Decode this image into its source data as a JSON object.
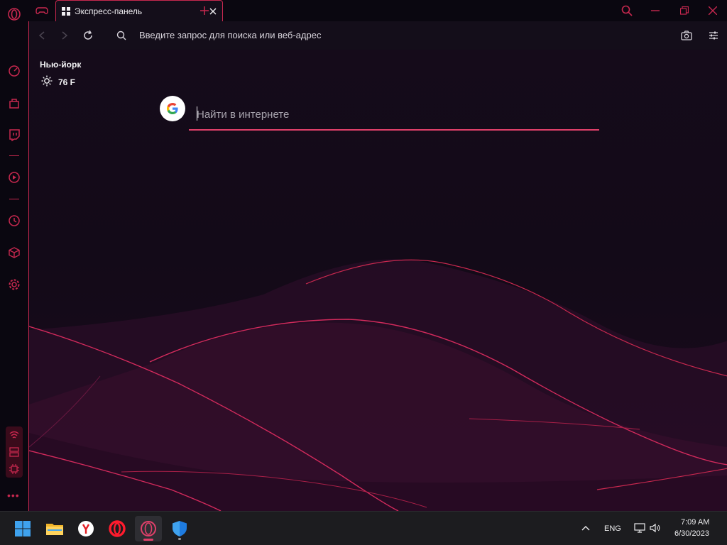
{
  "browser": {
    "tab_title": "Экспресс-панель",
    "address_placeholder": "Введите запрос для поиска или веб-адрес",
    "accent_color": "#c8284f"
  },
  "weather": {
    "city": "Нью-йорк",
    "temperature": "76 F",
    "condition_icon": "sun-icon"
  },
  "search": {
    "engine_icon": "google-g-icon",
    "placeholder": "Найти в интернете",
    "value": ""
  },
  "sidebar": {
    "items": [
      {
        "name": "speed-dial-icon"
      },
      {
        "name": "shopping-bag-icon"
      },
      {
        "name": "twitch-icon"
      },
      {
        "name": "player-icon"
      },
      {
        "name": "history-icon"
      },
      {
        "name": "extensions-cube-icon"
      },
      {
        "name": "settings-gear-icon"
      }
    ],
    "bottom_widgets": [
      "wifi-icon",
      "storage-icon",
      "cpu-icon"
    ],
    "more_label": "•••"
  },
  "taskbar": {
    "apps": [
      "windows-start-icon",
      "file-explorer-icon",
      "yandex-browser-icon",
      "opera-icon",
      "opera-gx-icon",
      "windows-security-icon"
    ],
    "language": "ENG",
    "time": "7:09 AM",
    "date": "6/30/2023"
  }
}
